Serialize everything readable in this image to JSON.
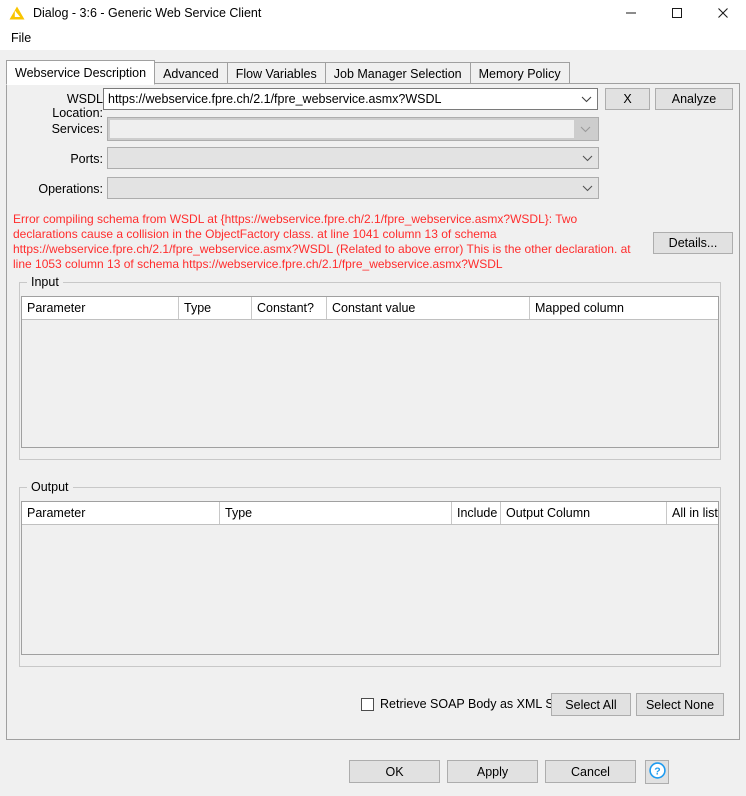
{
  "window": {
    "icon": "knime-triangle-icon",
    "title": "Dialog - 3:6 - Generic Web Service Client",
    "controls": {
      "minimize": "minimize-icon",
      "maximize": "maximize-icon",
      "close": "close-icon"
    }
  },
  "menubar": {
    "items": [
      {
        "label": "File"
      }
    ]
  },
  "tabs": [
    {
      "label": "Webservice Description",
      "active": true
    },
    {
      "label": "Advanced",
      "active": false
    },
    {
      "label": "Flow Variables",
      "active": false
    },
    {
      "label": "Job Manager Selection",
      "active": false
    },
    {
      "label": "Memory Policy",
      "active": false
    }
  ],
  "form": {
    "wsdl": {
      "label": "WSDL Location:",
      "value": "https://webservice.fpre.ch/2.1/fpre_webservice.asmx?WSDL",
      "clear_button": "X",
      "analyze_button": "Analyze"
    },
    "services": {
      "label": "Services:",
      "value": ""
    },
    "ports": {
      "label": "Ports:",
      "value": ""
    },
    "operations": {
      "label": "Operations:",
      "value": ""
    }
  },
  "error": {
    "color": "#ff2d2d",
    "message": "Error compiling schema from WSDL at {https://webservice.fpre.ch/2.1/fpre_webservice.asmx?WSDL}: Two declarations cause a collision in the ObjectFactory class. at line 1041 column 13 of schema https://webservice.fpre.ch/2.1/fpre_webservice.asmx?WSDL (Related to above error) This is the other declaration. at line 1053 column 13 of schema https://webservice.fpre.ch/2.1/fpre_webservice.asmx?WSDL",
    "details_button": "Details..."
  },
  "input_section": {
    "title": "Input",
    "columns": [
      "Parameter",
      "Type",
      "Constant?",
      "Constant value",
      "Mapped column"
    ],
    "rows": []
  },
  "output_section": {
    "title": "Output",
    "columns": [
      "Parameter",
      "Type",
      "Include",
      "Output Column",
      "All in list"
    ],
    "rows": []
  },
  "options": {
    "retrieve_soap_label": "Retrieve SOAP Body as XML String",
    "retrieve_soap_checked": false,
    "select_all": "Select All",
    "select_none": "Select None"
  },
  "footer": {
    "ok": "OK",
    "apply": "Apply",
    "cancel": "Cancel",
    "help": "help-icon"
  }
}
